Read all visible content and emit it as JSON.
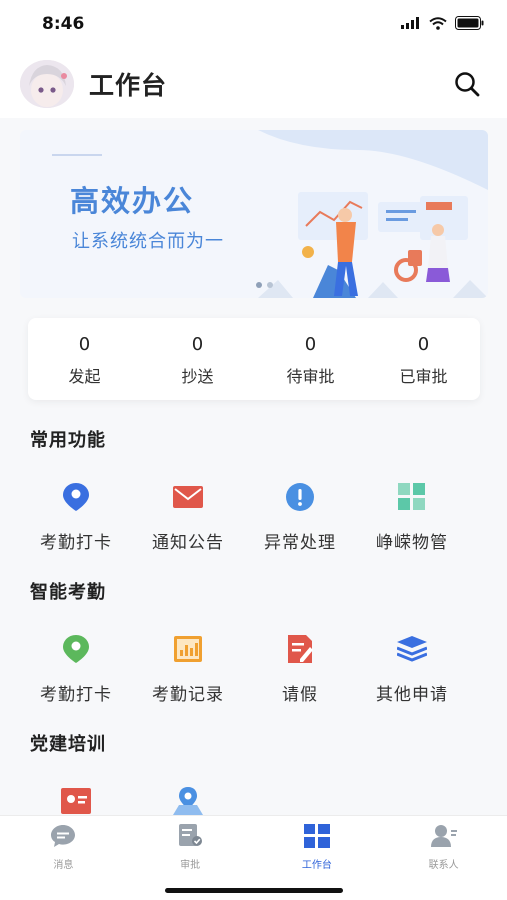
{
  "status": {
    "time": "8:46"
  },
  "header": {
    "title": "工作台"
  },
  "banner": {
    "title": "高效办公",
    "subtitle": "让系统统合而为一"
  },
  "stats": [
    {
      "value": "0",
      "label": "发起"
    },
    {
      "value": "0",
      "label": "抄送"
    },
    {
      "value": "0",
      "label": "待审批"
    },
    {
      "value": "0",
      "label": "已审批"
    }
  ],
  "sections": [
    {
      "title": "常用功能",
      "items": [
        {
          "label": "考勤打卡",
          "icon": "location-pin-icon",
          "color": "#3a6fe0"
        },
        {
          "label": "通知公告",
          "icon": "mail-icon",
          "color": "#e0574a"
        },
        {
          "label": "异常处理",
          "icon": "alert-icon",
          "color": "#4a90e2"
        },
        {
          "label": "峥嵘物管",
          "icon": "grid-icon",
          "color": "#5cc8a8"
        }
      ]
    },
    {
      "title": "智能考勤",
      "items": [
        {
          "label": "考勤打卡",
          "icon": "location-pin-icon",
          "color": "#5cb85c"
        },
        {
          "label": "考勤记录",
          "icon": "chart-icon",
          "color": "#f0a030"
        },
        {
          "label": "请假",
          "icon": "document-edit-icon",
          "color": "#e0574a"
        },
        {
          "label": "其他申请",
          "icon": "layers-icon",
          "color": "#3a6fe0"
        }
      ]
    },
    {
      "title": "党建培训",
      "items": [
        {
          "label": "",
          "icon": "id-card-icon",
          "color": "#e0574a"
        },
        {
          "label": "",
          "icon": "map-pin-icon",
          "color": "#4a90e2"
        }
      ]
    }
  ],
  "tabs": [
    {
      "label": "消息",
      "icon": "chat-icon",
      "active": false
    },
    {
      "label": "审批",
      "icon": "approve-icon",
      "active": false
    },
    {
      "label": "工作台",
      "icon": "dashboard-icon",
      "active": true
    },
    {
      "label": "联系人",
      "icon": "contact-icon",
      "active": false
    }
  ],
  "colors": {
    "accent": "#2f63d9",
    "banner_text": "#4a86d8"
  }
}
